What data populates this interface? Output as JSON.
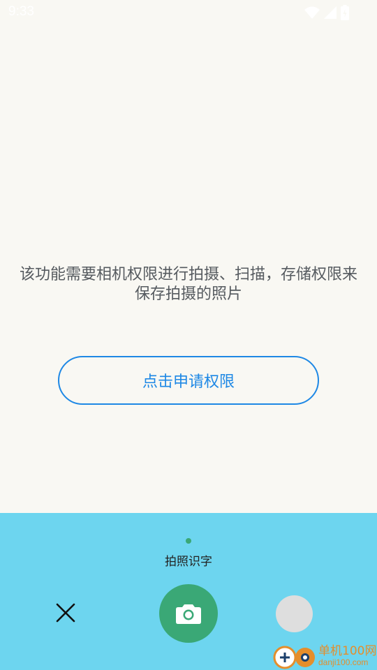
{
  "status_bar": {
    "time": "9:33",
    "icons": [
      "wifi-icon",
      "signal-icon",
      "battery-icon"
    ]
  },
  "main": {
    "permission_message": "该功能需要相机权限进行拍摄、扫描，存储权限来保存拍摄的照片",
    "permission_button": "点击申请权限"
  },
  "bottom": {
    "mode_label": "拍照识字",
    "close_icon": "close-icon",
    "shutter_icon": "camera-icon",
    "gallery": "gallery-thumbnail"
  },
  "watermark": {
    "title": "单机100网",
    "subtitle": "danji100.com"
  },
  "colors": {
    "background": "#f9f8f3",
    "panel": "#6dd5ef",
    "accent_green": "#3aa876",
    "accent_blue": "#1e88e5",
    "watermark": "#e58e2b"
  }
}
